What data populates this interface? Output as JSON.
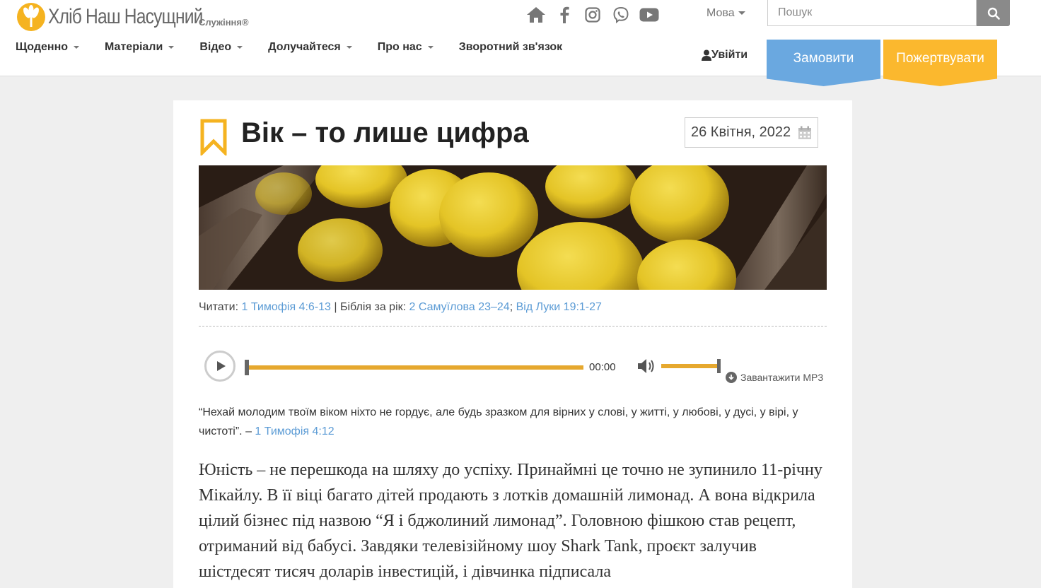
{
  "header": {
    "logo_title": "Хліб Наш Насущний",
    "logo_sub": "Служіння®",
    "icons": [
      "home-icon",
      "facebook-icon",
      "instagram-icon",
      "viber-icon",
      "youtube-icon"
    ],
    "lang_label": "Мова",
    "search_placeholder": "Пошук",
    "nav": [
      "Щоденно",
      "Матеріали",
      "Відео",
      "Долучайтеся",
      "Про нас",
      "Зворотний зв'язок"
    ],
    "login": "Увійти",
    "order": "Замовити",
    "donate": "Пожертвувати"
  },
  "colors": {
    "accent_blue": "#6aa8e0",
    "accent_yellow": "#fbb82e",
    "link": "#5b9bd5",
    "progress": "#e6a82e"
  },
  "article": {
    "title": "Вік – то лише цифра",
    "date": "26 Квітня, 2022",
    "read_label": "Читати:",
    "read_link": "1 Тимофія 4:6-13",
    "sep": "|",
    "bible_year_label": "Біблія за рік:",
    "bible_link_1": "2 Самуїлова 23–24",
    "semicolon": ";",
    "bible_link_2": "Від Луки 19:1-27",
    "audio_time": "00:00",
    "download_label": "Завантажити MP3",
    "quote_text": "“Нехай молодим твоїм віком ніхто не гордує, але будь зразком для вірних у слові, у житті, у любові, у дусі, у вірі, у чистоті”. –",
    "quote_link": "1 Тимофія 4:12",
    "body": "Юність – не перешкода на шляху до успіху. Принаймні це точно не зупинило 11-річну Мікайлу. В її віці багато дітей продають з лотків домашній лимонад. А вона відкрила цілий бізнес під назвою “Я і бджолиний лимонад”. Головною фішкою став рецепт, отриманий від бабусі. Завдяки телевізійному шоу Shark Tank, проєкт залучив шістдесят тисяч доларів інвестицій, і дівчинка підписала"
  }
}
